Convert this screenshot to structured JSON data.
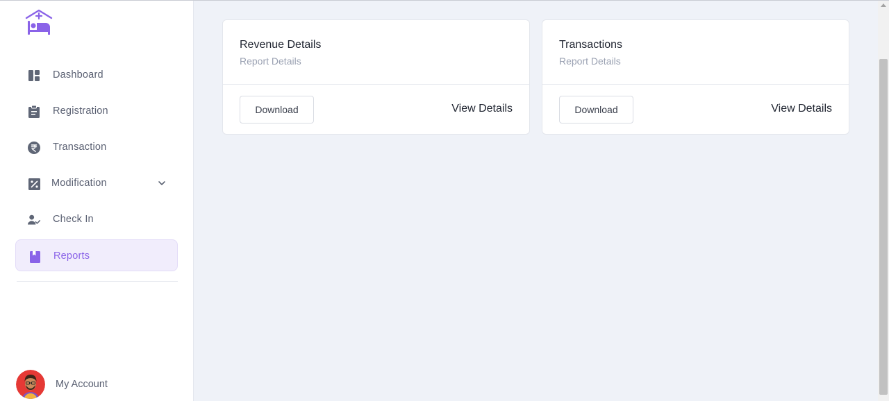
{
  "sidebar": {
    "logo_icon": "hotel-bed-logo-icon",
    "items": [
      {
        "label": "Dashboard",
        "icon": "dashboard-icon"
      },
      {
        "label": "Registration",
        "icon": "clipboard-icon"
      },
      {
        "label": "Transaction",
        "icon": "rupee-icon"
      },
      {
        "label": "Modification",
        "icon": "percent-edit-icon",
        "has_submenu": true
      },
      {
        "label": "Check In",
        "icon": "user-check-icon"
      },
      {
        "label": "Reports",
        "icon": "bookmark-icon",
        "active": true
      }
    ],
    "account": {
      "label": "My Account",
      "icon": "avatar"
    }
  },
  "cards": [
    {
      "title": "Revenue Details",
      "subtitle": "Report Details",
      "download_label": "Download",
      "view_label": "View Details"
    },
    {
      "title": "Transactions",
      "subtitle": "Report Details",
      "download_label": "Download",
      "view_label": "View Details"
    }
  ],
  "colors": {
    "accent": "#8a63e8",
    "active_bg": "#f1edfc",
    "icon": "#5f6676",
    "page_bg": "#eff2f8"
  }
}
